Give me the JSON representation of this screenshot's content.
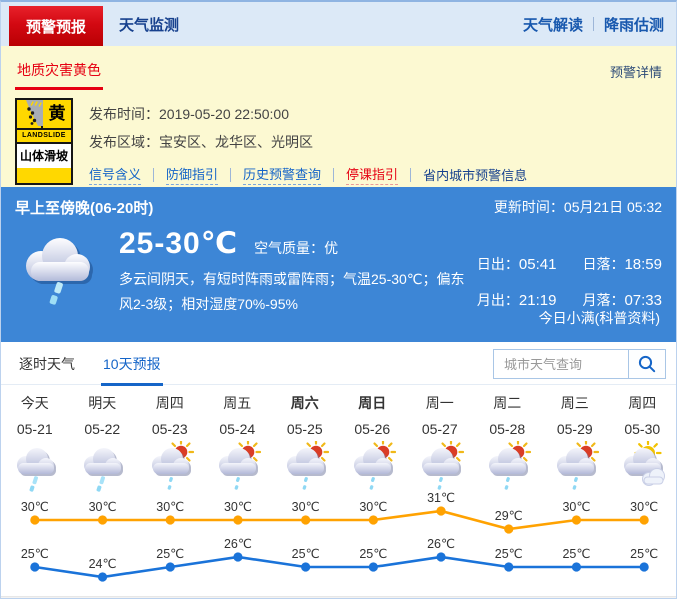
{
  "topbar": {
    "tabs": [
      {
        "label": "预警预报",
        "active": true
      },
      {
        "label": "天气监测",
        "active": false
      }
    ],
    "links": [
      "天气解读",
      "降雨估测"
    ]
  },
  "warning": {
    "tab": "地质灾害黄色",
    "detail_link": "预警详情",
    "icon": {
      "color_char": "黄",
      "en_label": "LANDSLIDE",
      "cn_label": "山体滑坡"
    },
    "publish_time_label": "发布时间：",
    "publish_time": "2019-05-20 22:50:00",
    "publish_area_label": "发布区域：",
    "publish_area": "宝安区、龙华区、光明区",
    "links": [
      {
        "label": "信号含义"
      },
      {
        "label": "防御指引"
      },
      {
        "label": "历史预警查询"
      },
      {
        "label": "停课指引"
      },
      {
        "label": "省内城市预警信息"
      }
    ]
  },
  "current": {
    "period": "早上至傍晚(06-20时)",
    "update_label": "更新时间：",
    "update_value": "05月21日 05:32",
    "temp_range": "25-30℃",
    "air_quality_label": "空气质量：",
    "air_quality_value": "优",
    "description": "多云间阴天，有短时阵雨或雷阵雨；气温25-30℃；偏东风2-3级；相对湿度70%-95%",
    "sunmoon": [
      {
        "label": "日出：",
        "value": "05:41"
      },
      {
        "label": "日落：",
        "value": "18:59"
      },
      {
        "label": "月出：",
        "value": "21:19"
      },
      {
        "label": "月落：",
        "value": "07:33"
      }
    ],
    "solar_term": "今日小满(科普资料)"
  },
  "forecast_tabs": [
    {
      "label": "逐时天气",
      "active": false
    },
    {
      "label": "10天预报",
      "active": true
    }
  ],
  "search": {
    "placeholder": "城市天气查询"
  },
  "chart_data": {
    "type": "line",
    "title": "10天预报",
    "categories": [
      "今天",
      "明天",
      "周四",
      "周五",
      "周六",
      "周日",
      "周一",
      "周二",
      "周三",
      "周四"
    ],
    "dates": [
      "05-21",
      "05-22",
      "05-23",
      "05-24",
      "05-25",
      "05-26",
      "05-27",
      "05-28",
      "05-29",
      "05-30"
    ],
    "weather_icons": [
      "rain",
      "rain",
      "sun-shower",
      "sun-shower",
      "sun-shower",
      "sun-shower",
      "sun-shower",
      "sun-shower",
      "sun-shower",
      "partly-cloudy"
    ],
    "series": [
      {
        "name": "high",
        "color": "#ffa201",
        "values": [
          30,
          30,
          30,
          30,
          30,
          30,
          31,
          29,
          30,
          30
        ]
      },
      {
        "name": "low",
        "color": "#1a73d9",
        "values": [
          25,
          24,
          25,
          26,
          25,
          25,
          26,
          25,
          25,
          25
        ]
      }
    ],
    "unit": "℃",
    "ylim": [
      22,
      33
    ],
    "grid": false,
    "legend": "none"
  },
  "colors": {
    "accent_red": "#d30912",
    "link_blue": "#1464c8",
    "panel_blue": "#3d86d6",
    "warning_yellow": "#ffd800",
    "high_line": "#ffa201",
    "low_line": "#1a73d9"
  }
}
